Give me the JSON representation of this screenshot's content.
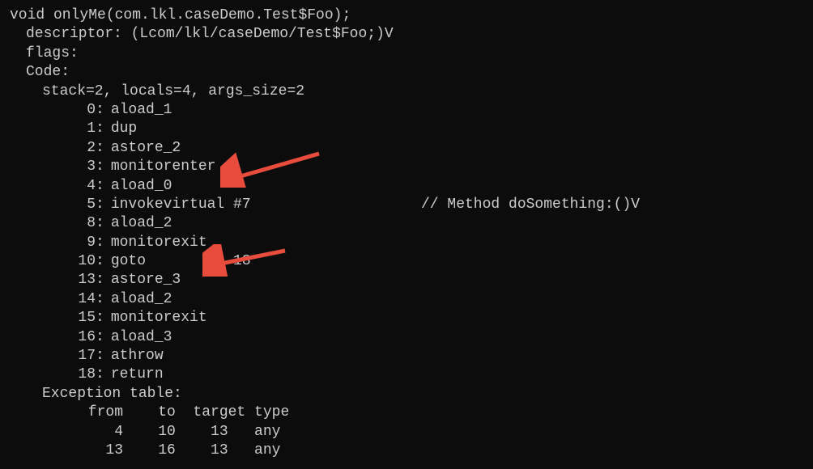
{
  "method_signature": "void onlyMe(com.lkl.caseDemo.Test$Foo);",
  "descriptor_label": "descriptor: ",
  "descriptor_value": "(Lcom/lkl/caseDemo/Test$Foo;)V",
  "flags_label": "flags:",
  "code_label": "Code:",
  "stack_info": "stack=2, locals=4, args_size=2",
  "bytecode": [
    {
      "offset": "0",
      "instr": "aload_1"
    },
    {
      "offset": "1",
      "instr": "dup"
    },
    {
      "offset": "2",
      "instr": "astore_2"
    },
    {
      "offset": "3",
      "instr": "monitorenter"
    },
    {
      "offset": "4",
      "instr": "aload_0"
    },
    {
      "offset": "5",
      "instr": "invokevirtual #7",
      "comment": "// Method doSomething:()V"
    },
    {
      "offset": "8",
      "instr": "aload_2"
    },
    {
      "offset": "9",
      "instr": "monitorexit"
    },
    {
      "offset": "10",
      "instr": "goto          18"
    },
    {
      "offset": "13",
      "instr": "astore_3"
    },
    {
      "offset": "14",
      "instr": "aload_2"
    },
    {
      "offset": "15",
      "instr": "monitorexit"
    },
    {
      "offset": "16",
      "instr": "aload_3"
    },
    {
      "offset": "17",
      "instr": "athrow"
    },
    {
      "offset": "18",
      "instr": "return"
    }
  ],
  "exception_table_label": "Exception table:",
  "exception_table_header": " from    to  target type",
  "exception_table_rows": [
    "    4    10    13   any",
    "   13    16    13   any"
  ]
}
